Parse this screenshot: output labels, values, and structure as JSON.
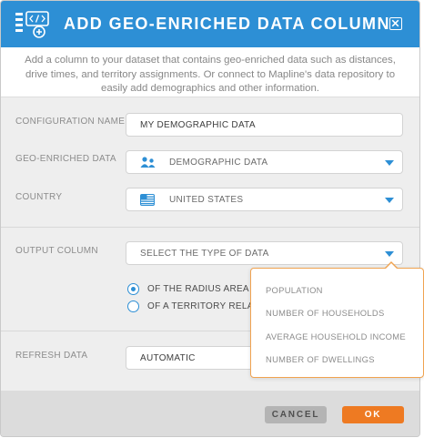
{
  "dialog": {
    "title": "ADD GEO-ENRICHED DATA COLUMN",
    "description": "Add a column to your dataset that contains geo-enriched data such as distances, drive times, and territory assignments. Or connect to Mapline's data repository to easily add demographics and other information."
  },
  "form": {
    "config_name": {
      "label": "CONFIGURATION NAME",
      "value": "MY DEMOGRAPHIC DATA"
    },
    "geo_data": {
      "label": "GEO-ENRICHED DATA",
      "value": "DEMOGRAPHIC DATA",
      "icon": "demographics-icon"
    },
    "country": {
      "label": "COUNTRY",
      "value": "UNITED STATES",
      "icon": "us-flag-icon"
    },
    "output_column": {
      "label": "OUTPUT COLUMN",
      "placeholder": "SELECT THE TYPE OF DATA",
      "radio_radius": "OF THE RADIUS AREA",
      "radio_territory": "OF A TERRITORY RELA"
    },
    "refresh": {
      "label": "REFRESH DATA",
      "value": "AUTOMATIC"
    }
  },
  "dropdown": {
    "options": [
      "POPULATION",
      "NUMBER OF HOUSEHOLDS",
      "AVERAGE HOUSEHOLD INCOME",
      "NUMBER OF DWELLINGS"
    ]
  },
  "footer": {
    "cancel_label": "CANCEL",
    "ok_label": "OK"
  },
  "colors": {
    "header": "#2d8fd5",
    "accent": "#2d8fd5",
    "ok": "#ee7a22",
    "dropdown_border": "#f0a350"
  }
}
